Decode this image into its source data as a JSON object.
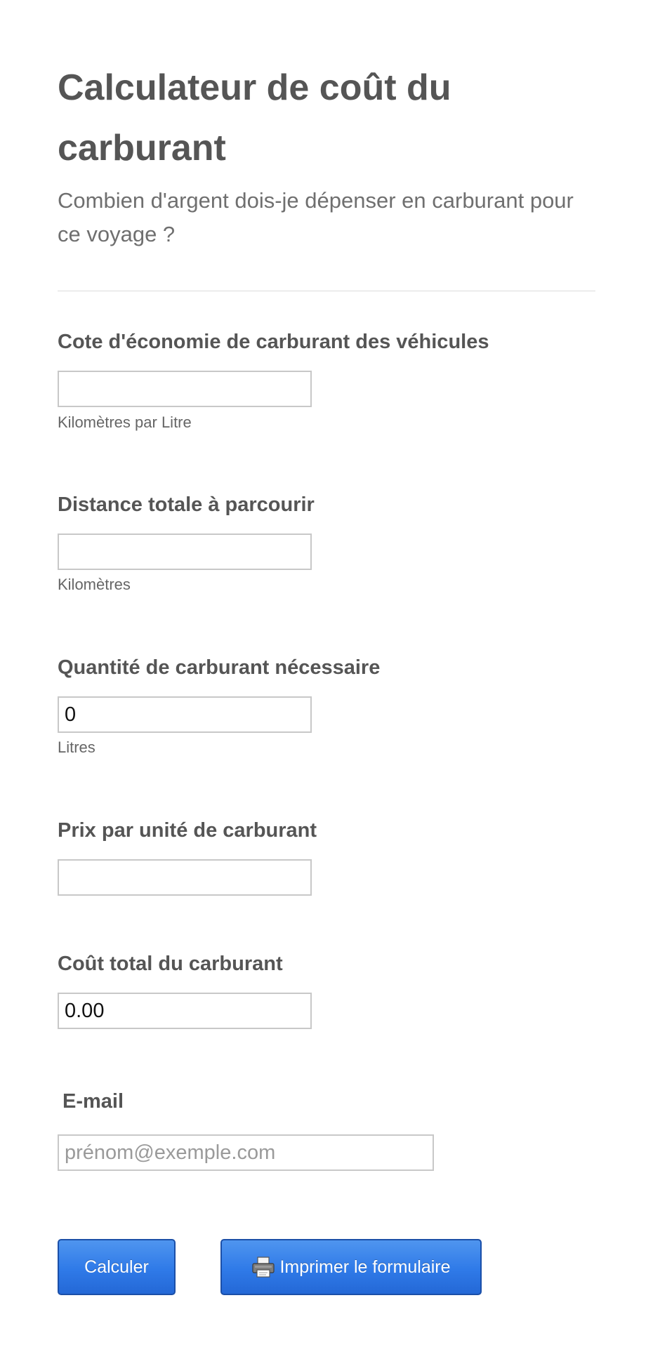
{
  "header": {
    "title": "Calculateur de coût du carburant",
    "subtitle": "Combien d'argent dois-je dépenser en carburant pour ce voyage ?"
  },
  "fields": {
    "fuel_economy": {
      "label": "Cote d'économie de carburant des véhicules",
      "value": "",
      "hint": "Kilomètres par Litre"
    },
    "distance": {
      "label": "Distance totale à parcourir",
      "value": "",
      "hint": "Kilomètres"
    },
    "fuel_needed": {
      "label": "Quantité de carburant nécessaire",
      "value": "0",
      "hint": "Litres"
    },
    "price_per_unit": {
      "label": "Prix par unité de carburant",
      "value": ""
    },
    "total_cost": {
      "label": "Coût total du carburant",
      "value": "0.00"
    },
    "email": {
      "label": "E-mail",
      "value": "",
      "placeholder": "prénom@exemple.com"
    }
  },
  "buttons": {
    "calculate_label": "Calculer",
    "print_label": "Imprimer le formulaire",
    "print_icon": "printer-icon",
    "accent_color": "#2f7ae8"
  }
}
